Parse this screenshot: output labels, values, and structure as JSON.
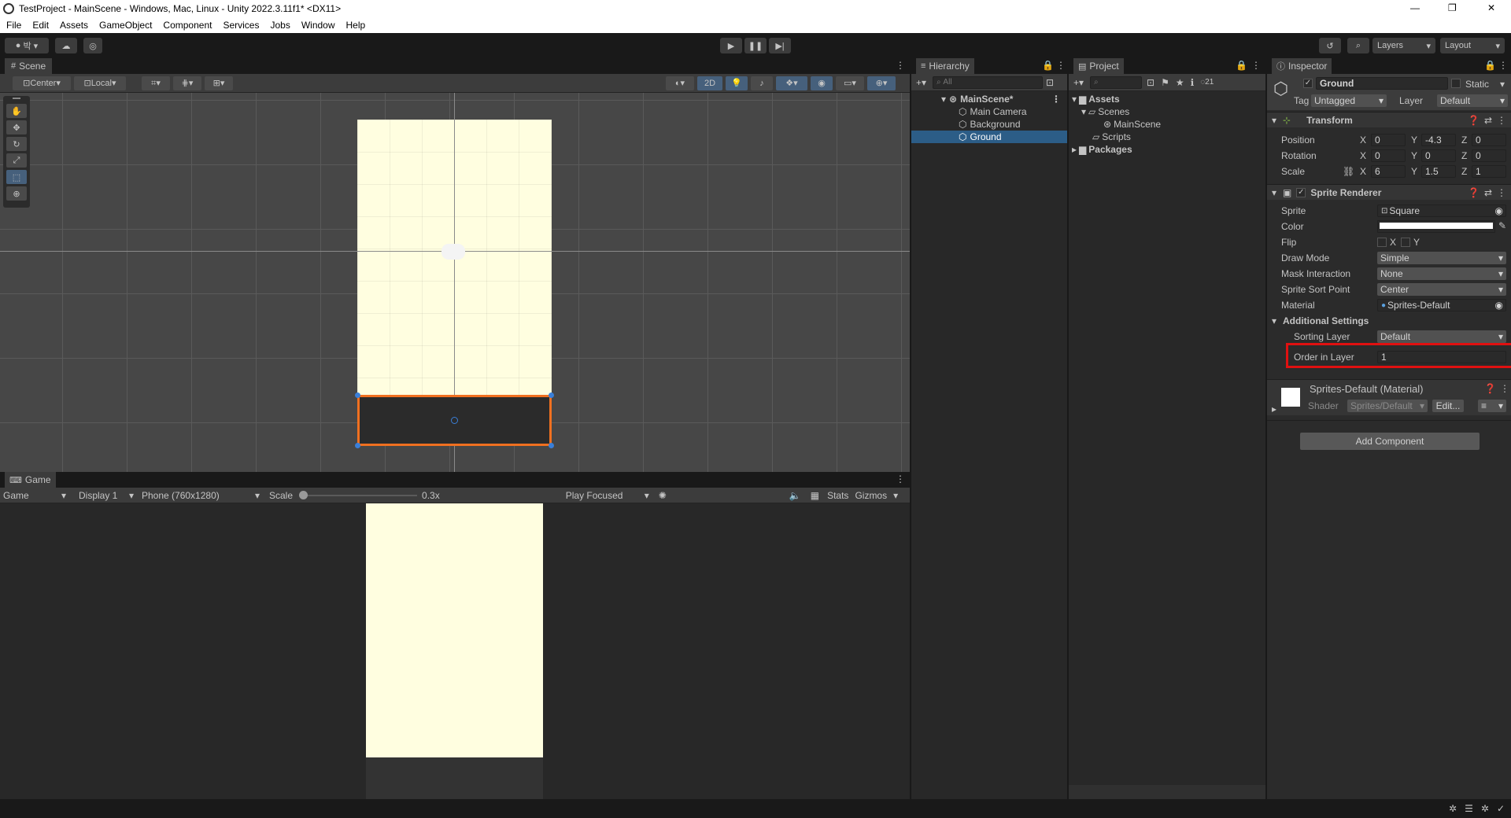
{
  "window": {
    "title": "TestProject - MainScene - Windows, Mac, Linux - Unity 2022.3.11f1* <DX11>",
    "min": "—",
    "max": "❐",
    "close": "✕"
  },
  "menu": [
    "File",
    "Edit",
    "Assets",
    "GameObject",
    "Component",
    "Services",
    "Jobs",
    "Window",
    "Help"
  ],
  "toolbar": {
    "account": "박",
    "layers": "Layers",
    "layout": "Layout"
  },
  "scene": {
    "tab": "Scene",
    "pivot": "Center",
    "space": "Local",
    "mode2d": "2D"
  },
  "game": {
    "tab": "Game",
    "view": "Game",
    "display": "Display 1",
    "resolution": "Phone (760x1280)",
    "scale_label": "Scale",
    "scale_value": "0.3x",
    "play_mode": "Play Focused",
    "stats": "Stats",
    "gizmos": "Gizmos"
  },
  "hierarchy": {
    "tab": "Hierarchy",
    "search": "All",
    "scene": "MainScene*",
    "items": [
      "Main Camera",
      "Background",
      "Ground"
    ],
    "selected": "Ground"
  },
  "project": {
    "tab": "Project",
    "hidden_count": "21",
    "tree": {
      "assets": "Assets",
      "scenes": "Scenes",
      "mainscene": "MainScene",
      "scripts": "Scripts",
      "packages": "Packages"
    }
  },
  "inspector": {
    "tab": "Inspector",
    "object_name": "Ground",
    "static_label": "Static",
    "tag_label": "Tag",
    "tag": "Untagged",
    "layer_label": "Layer",
    "layer": "Default",
    "transform": {
      "title": "Transform",
      "position": {
        "label": "Position",
        "x": "0",
        "y": "-4.3",
        "z": "0"
      },
      "rotation": {
        "label": "Rotation",
        "x": "0",
        "y": "0",
        "z": "0"
      },
      "scale": {
        "label": "Scale",
        "x": "6",
        "y": "1.5",
        "z": "1"
      },
      "axis": {
        "x": "X",
        "y": "Y",
        "z": "Z"
      }
    },
    "sprite_renderer": {
      "title": "Sprite Renderer",
      "sprite_label": "Sprite",
      "sprite": "Square",
      "color_label": "Color",
      "flip_label": "Flip",
      "flip_x": "X",
      "flip_y": "Y",
      "draw_mode_label": "Draw Mode",
      "draw_mode": "Simple",
      "mask_label": "Mask Interaction",
      "mask": "None",
      "sort_point_label": "Sprite Sort Point",
      "sort_point": "Center",
      "material_label": "Material",
      "material": "Sprites-Default",
      "additional": "Additional Settings",
      "sorting_layer_label": "Sorting Layer",
      "sorting_layer": "Default",
      "order_label": "Order in Layer",
      "order": "1"
    },
    "material": {
      "title": "Sprites-Default (Material)",
      "shader_label": "Shader",
      "shader": "Sprites/Default",
      "edit": "Edit..."
    },
    "add_component": "Add Component"
  },
  "colors": {
    "highlight": "#e01010",
    "selection": "#2c5d87",
    "scene_bg": "#fffee0",
    "ground": "#2b2b2b",
    "ground_outline": "#f07020"
  }
}
